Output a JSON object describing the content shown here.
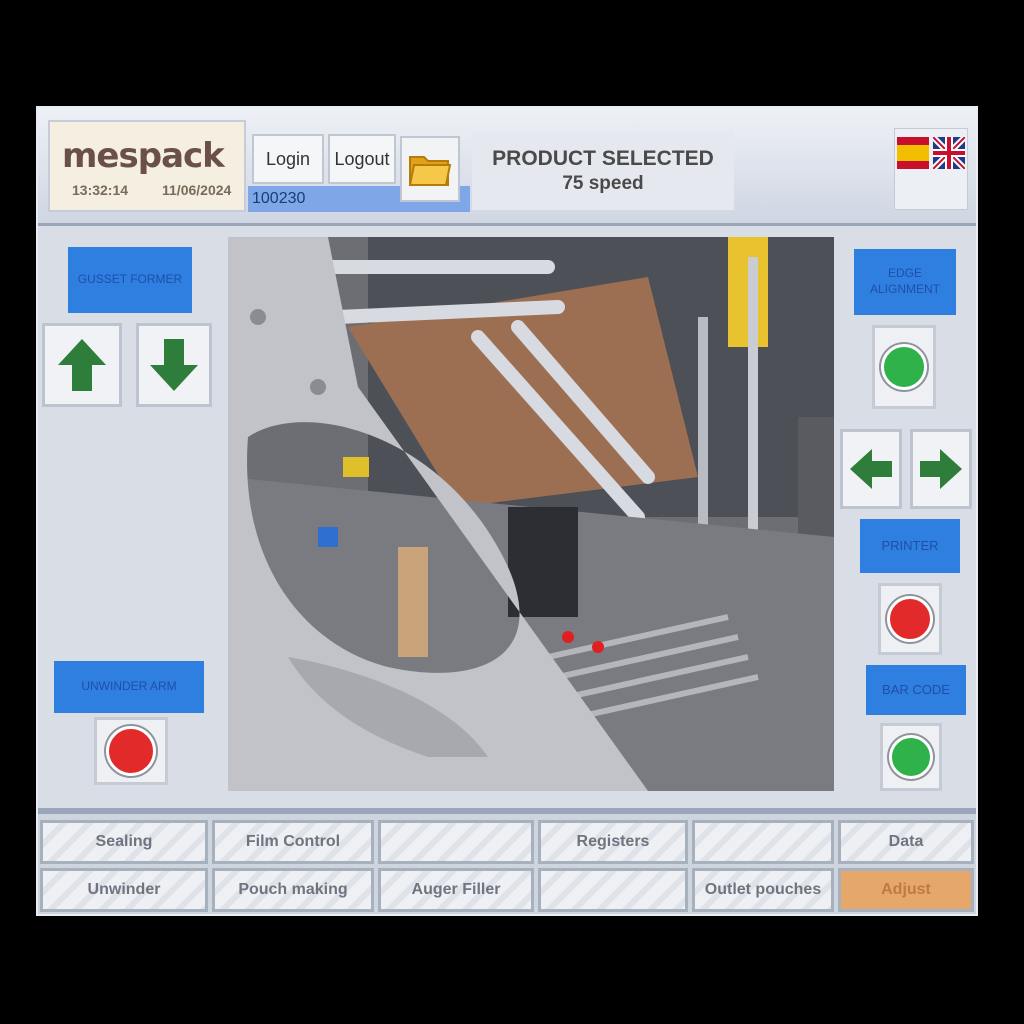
{
  "header": {
    "logo": "mespack",
    "time": "13:32:14",
    "date": "11/06/2024",
    "login_label": "Login",
    "logout_label": "Logout",
    "id_value": "100230",
    "product_line1": "PRODUCT SELECTED",
    "product_line2": "75 speed"
  },
  "left_panel": {
    "gusset_label": "GUSSET FORMER",
    "unwinder_label": "UNWINDER ARM"
  },
  "right_panel": {
    "edge_label": "EDGE ALIGNMENT",
    "printer_label": "PRINTER",
    "barcode_label": "BAR CODE"
  },
  "colors": {
    "lamp_green": "#2fb24a",
    "lamp_red": "#e22a2a",
    "arrow_green": "#2e7d3a",
    "label_blue": "#2f7fe0"
  },
  "menu": {
    "row1": [
      "Sealing",
      "Film Control",
      "",
      "Registers",
      "",
      "Data"
    ],
    "row2": [
      "Unwinder",
      "Pouch making",
      "Auger Filler",
      "",
      "Outlet pouches",
      "Adjust"
    ]
  }
}
